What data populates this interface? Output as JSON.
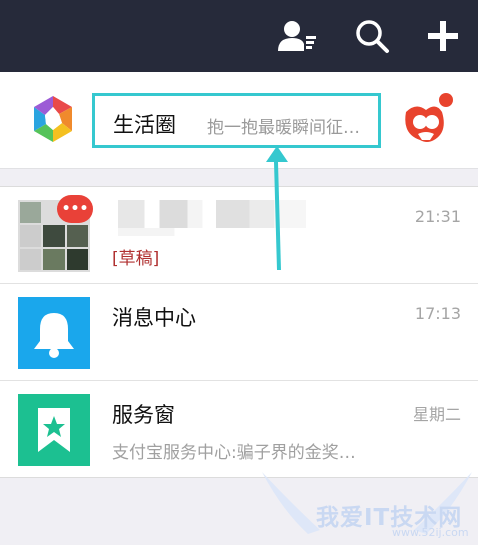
{
  "header": {
    "contacts_icon": "contacts-list-icon",
    "search_icon": "search-icon",
    "add_icon": "plus-icon"
  },
  "life_circle": {
    "title": "生活圈",
    "subtitle": "抱一抱最暖瞬间征…"
  },
  "chats": [
    {
      "name": "",
      "time": "21:31",
      "preview": "[草稿]",
      "badge": "•••"
    },
    {
      "name": "消息中心",
      "time": "17:13",
      "preview": ""
    },
    {
      "name": "服务窗",
      "time": "星期二",
      "preview": "支付宝服务中心:骗子界的金奖…"
    }
  ],
  "watermark": {
    "text": "我爱IT技术网",
    "url": "www.52ij.com"
  },
  "colors": {
    "header_bg": "#262a3a",
    "highlight": "#35c8cf",
    "bell_bg": "#1aa7ec",
    "service_bg": "#1cc091",
    "badge": "#e94138"
  }
}
